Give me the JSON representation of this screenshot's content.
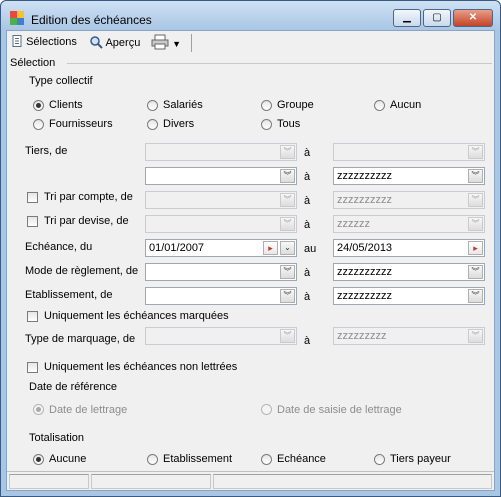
{
  "window": {
    "title": "Edition des échéances"
  },
  "toolbar": {
    "selections": "Sélections",
    "apercu": "Aperçu"
  },
  "section": {
    "title": "Sélection"
  },
  "type_collectif": {
    "label": "Type collectif",
    "options": [
      "Clients",
      "Salariés",
      "Groupe",
      "Aucun",
      "Fournisseurs",
      "Divers",
      "Tous"
    ],
    "selected": "Clients"
  },
  "fields": {
    "tiers_label": "Tiers, de",
    "a": "à",
    "au": "au",
    "tiers_to2": "zzzzzzzzzz",
    "tri_compte_label": "Tri par compte, de",
    "tri_compte_to": "zzzzzzzzzz",
    "tri_devise_label": "Tri par devise, de",
    "tri_devise_to": "zzzzzz",
    "echeance_label": "Echéance, du",
    "echeance_from": "01/01/2007",
    "echeance_to": "24/05/2013",
    "mode_label": "Mode de règlement, de",
    "mode_to": "zzzzzzzzzz",
    "etab_label": "Etablissement, de",
    "etab_to": "zzzzzzzzzz",
    "marquees_label": "Uniquement les échéances marquées",
    "type_marquage_label": "Type de marquage, de",
    "type_marquage_to": "zzzzzzzzz",
    "non_lettrees_label": "Uniquement les échéances non lettrées"
  },
  "date_ref": {
    "label": "Date de référence",
    "options": [
      "Date de lettrage",
      "Date de saisie de lettrage"
    ],
    "selected": "Date de lettrage"
  },
  "totalisation": {
    "label": "Totalisation",
    "options": [
      "Aucune",
      "Etablissement",
      "Echéance",
      "Tiers payeur"
    ],
    "selected": "Aucune"
  },
  "colors": {
    "titlebar": "#a9c6e4",
    "client_bg": "#f0f0f0",
    "date_button": "#c0392b"
  }
}
